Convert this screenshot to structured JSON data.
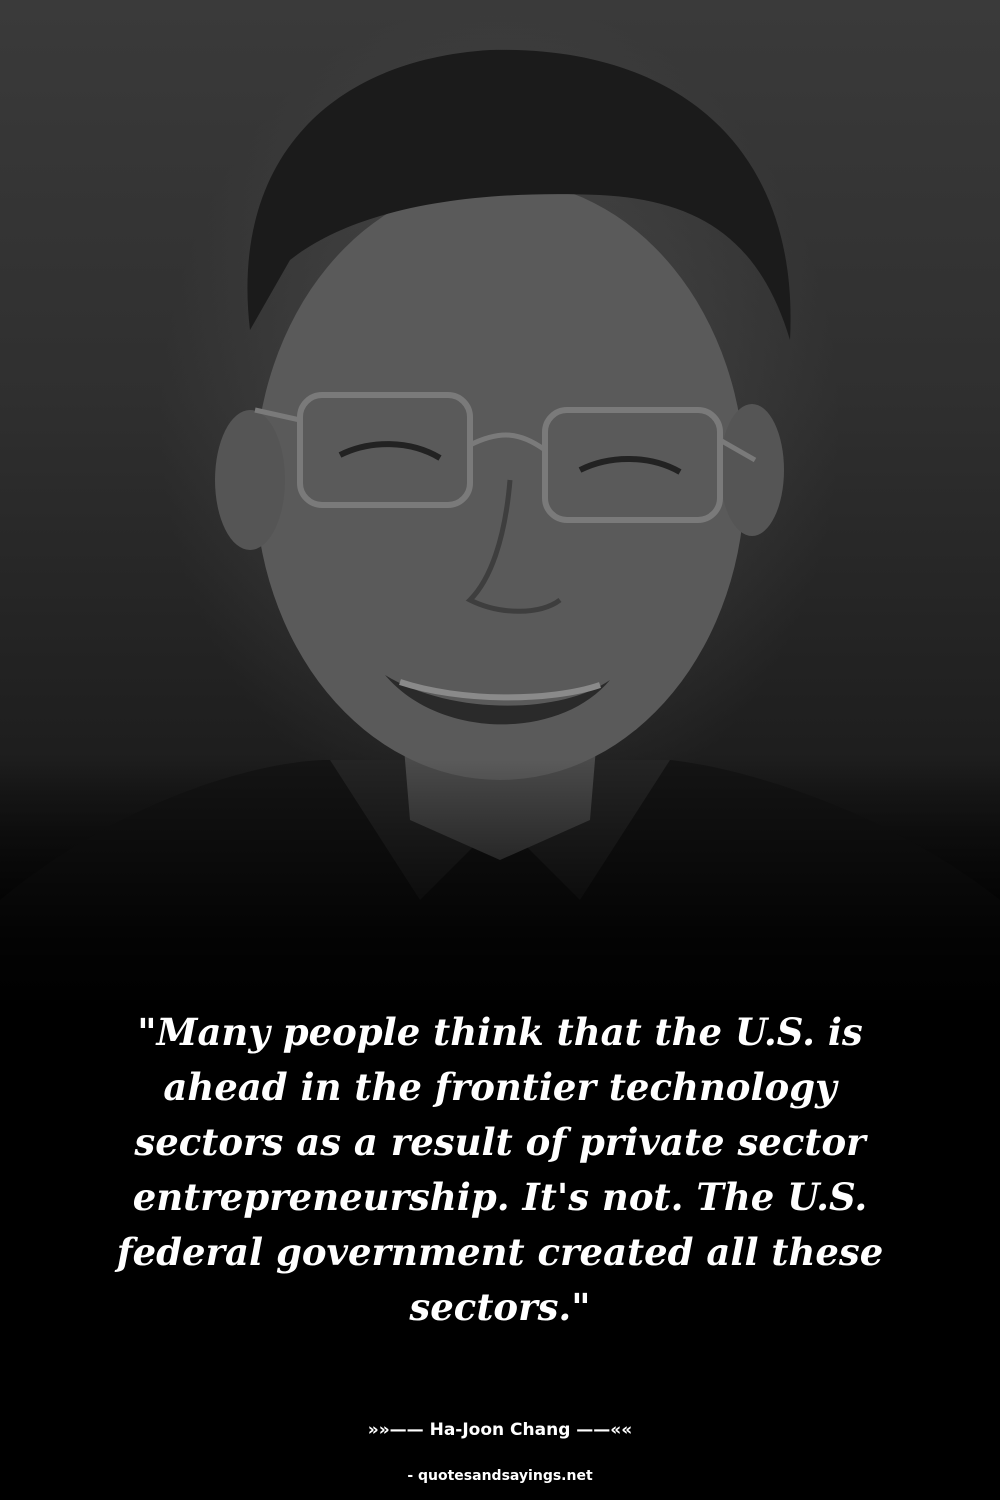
{
  "quote": {
    "text": "\"Many people think that the U.S. is ahead in the frontier technology sectors as a result of private sector entrepreneurship. It's not. The U.S. federal government created all these sectors.\""
  },
  "author": {
    "line": "»»—— Ha-Joon Chang ——««"
  },
  "site": {
    "credit": "- quotesandsayings.net"
  },
  "colors": {
    "background": "#000000",
    "text": "#ffffff"
  }
}
